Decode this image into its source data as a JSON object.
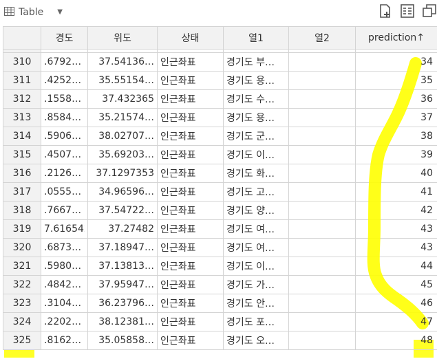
{
  "toolbar": {
    "view_label": "Table",
    "view_icon": "table-icon",
    "actions": [
      "new-file-icon",
      "list-view-icon",
      "copy-window-icon"
    ]
  },
  "table": {
    "columns": [
      "",
      "경도",
      "위도",
      "상태",
      "열1",
      "열2",
      "prediction"
    ],
    "sort_indicator": "↑",
    "rows": [
      {
        "idx": "310",
        "lng": ".6792…",
        "lat": "37.54136…",
        "status": "인근좌표",
        "col1": "경기도 부…",
        "col2": "",
        "pred": "34"
      },
      {
        "idx": "311",
        "lng": ".4252…",
        "lat": "35.55154…",
        "status": "인근좌표",
        "col1": "경기도 용…",
        "col2": "",
        "pred": "35"
      },
      {
        "idx": "312",
        "lng": ".1558…",
        "lat": "37.432365",
        "status": "인근좌표",
        "col1": "경기도 수…",
        "col2": "",
        "pred": "36"
      },
      {
        "idx": "313",
        "lng": ".8584…",
        "lat": "35.21574…",
        "status": "인근좌표",
        "col1": "경기도 용…",
        "col2": "",
        "pred": "37"
      },
      {
        "idx": "314",
        "lng": ".5906…",
        "lat": "38.02707…",
        "status": "인근좌표",
        "col1": "경기도 군…",
        "col2": "",
        "pred": "38"
      },
      {
        "idx": "315",
        "lng": ".4507…",
        "lat": "35.69203…",
        "status": "인근좌표",
        "col1": "경기도 이…",
        "col2": "",
        "pred": "39"
      },
      {
        "idx": "316",
        "lng": ".2126…",
        "lat": "37.1297353",
        "status": "인근좌표",
        "col1": "경기도 화…",
        "col2": "",
        "pred": "40"
      },
      {
        "idx": "317",
        "lng": ".0555…",
        "lat": "34.96596…",
        "status": "인근좌표",
        "col1": "경기도 고…",
        "col2": "",
        "pred": "41"
      },
      {
        "idx": "318",
        "lng": ".7667…",
        "lat": "37.54722…",
        "status": "인근좌표",
        "col1": "경기도 양…",
        "col2": "",
        "pred": "42"
      },
      {
        "idx": "319",
        "lng": "7.616542",
        "lat": "37.27482",
        "status": "인근좌표",
        "col1": "경기도 여…",
        "col2": "",
        "pred": "43"
      },
      {
        "idx": "320",
        "lng": ".6873…",
        "lat": "37.18947…",
        "status": "인근좌표",
        "col1": "경기도 여…",
        "col2": "",
        "pred": "43"
      },
      {
        "idx": "321",
        "lng": ".5980…",
        "lat": "37.13813…",
        "status": "인근좌표",
        "col1": "경기도 이…",
        "col2": "",
        "pred": "44"
      },
      {
        "idx": "322",
        "lng": ".4842…",
        "lat": "37.95947…",
        "status": "인근좌표",
        "col1": "경기도 가…",
        "col2": "",
        "pred": "45"
      },
      {
        "idx": "323",
        "lng": ".3104…",
        "lat": "36.23796…",
        "status": "인근좌표",
        "col1": "경기도 안…",
        "col2": "",
        "pred": "46"
      },
      {
        "idx": "324",
        "lng": ".2202…",
        "lat": "38.12381…",
        "status": "인근좌표",
        "col1": "경기도 포…",
        "col2": "",
        "pred": "47"
      },
      {
        "idx": "325",
        "lng": ".8162…",
        "lat": "35.05858…",
        "status": "인근좌표",
        "col1": "경기도 오…",
        "col2": "",
        "pred": "48"
      }
    ]
  },
  "highlight_color": "#ffff00"
}
